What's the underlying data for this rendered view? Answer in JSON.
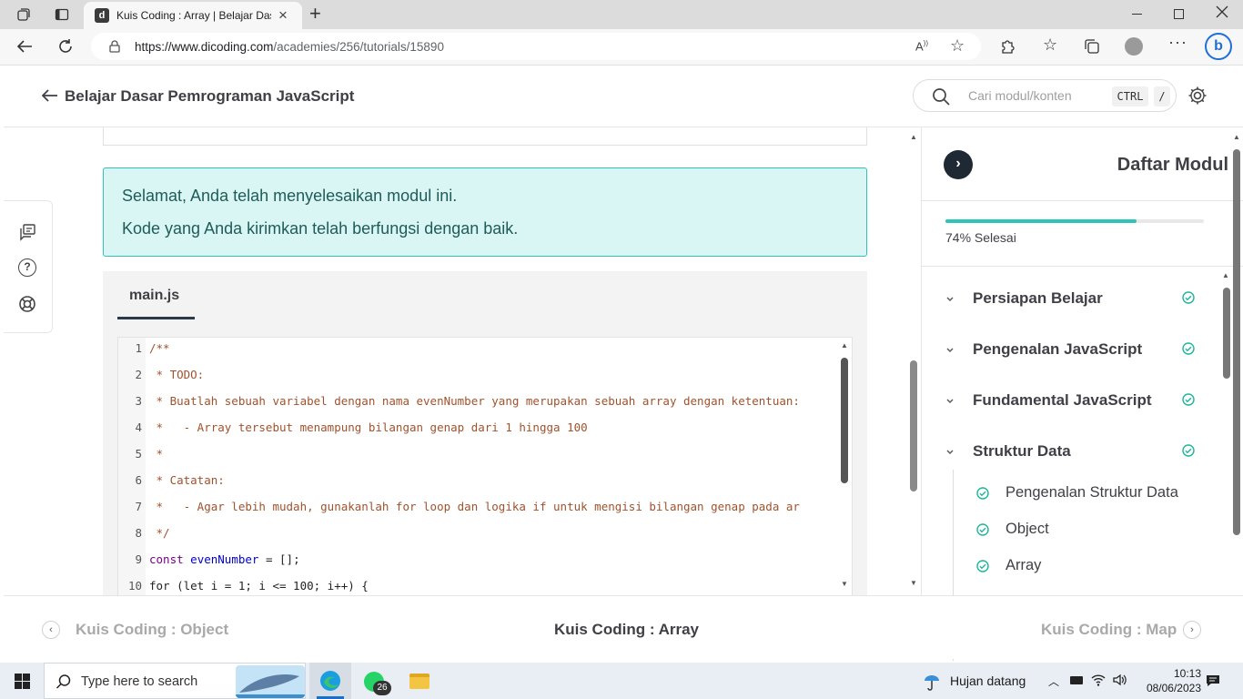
{
  "browser": {
    "tab_title": "Kuis Coding : Array | Belajar Dasar Pemrograman JavaScript",
    "tab_favicon": "d",
    "url_domain": "https://www.dicoding.com",
    "url_path": "/academies/256/tutorials/15890",
    "close_tab_label": "×",
    "new_tab_label": "+"
  },
  "header": {
    "course_title": "Belajar Dasar Pemrograman JavaScript",
    "search_placeholder": "Cari modul/konten",
    "kbd_ctrl": "CTRL",
    "kbd_slash": "/"
  },
  "alert": {
    "line1": "Selamat, Anda telah menyelesaikan modul ini.",
    "line2": "Kode yang Anda kirimkan telah berfungsi dengan baik."
  },
  "editor": {
    "file_tab": "main.js",
    "lines": [
      {
        "n": "1",
        "text": "/**"
      },
      {
        "n": "2",
        "text": " * TODO:"
      },
      {
        "n": "3",
        "text": " * Buatlah sebuah variabel dengan nama evenNumber yang merupakan sebuah array dengan ketentuan:"
      },
      {
        "n": "4",
        "text": " *   - Array tersebut menampung bilangan genap dari 1 hingga 100"
      },
      {
        "n": "5",
        "text": " *"
      },
      {
        "n": "6",
        "text": " * Catatan:"
      },
      {
        "n": "7",
        "text": " *   - Agar lebih mudah, gunakanlah for loop dan logika if untuk mengisi bilangan genap pada ar"
      },
      {
        "n": "8",
        "text": " */"
      },
      {
        "n": "9",
        "kw": "const",
        "var": "evenNumber",
        "rest": " = [];"
      },
      {
        "n": "10",
        "text": "for (let i = 1; i <= 100; i++) {"
      }
    ]
  },
  "sidebar": {
    "title": "Daftar Modul",
    "progress_percent": 74,
    "progress_text": "74% Selesai",
    "modules": [
      {
        "label": "Persiapan Belajar",
        "done": true
      },
      {
        "label": "Pengenalan JavaScript",
        "done": true
      },
      {
        "label": "Fundamental JavaScript",
        "done": true
      },
      {
        "label": "Struktur Data",
        "done": true
      }
    ],
    "submodules": [
      {
        "label": "Pengenalan Struktur Data",
        "done": true
      },
      {
        "label": "Object",
        "done": true
      },
      {
        "label": "Array",
        "done": true
      }
    ]
  },
  "bottom_nav": {
    "prev": "Kuis Coding : Object",
    "current": "Kuis Coding : Array",
    "next": "Kuis Coding : Map"
  },
  "taskbar": {
    "search_placeholder": "Type here to search",
    "whatsapp_badge": "26",
    "weather": "Hujan datang",
    "time": "10:13",
    "date": "08/06/2023"
  },
  "colors": {
    "accent": "#2ec4b6",
    "alert_bg": "#d9f6f4",
    "heading": "#3f3f46"
  }
}
